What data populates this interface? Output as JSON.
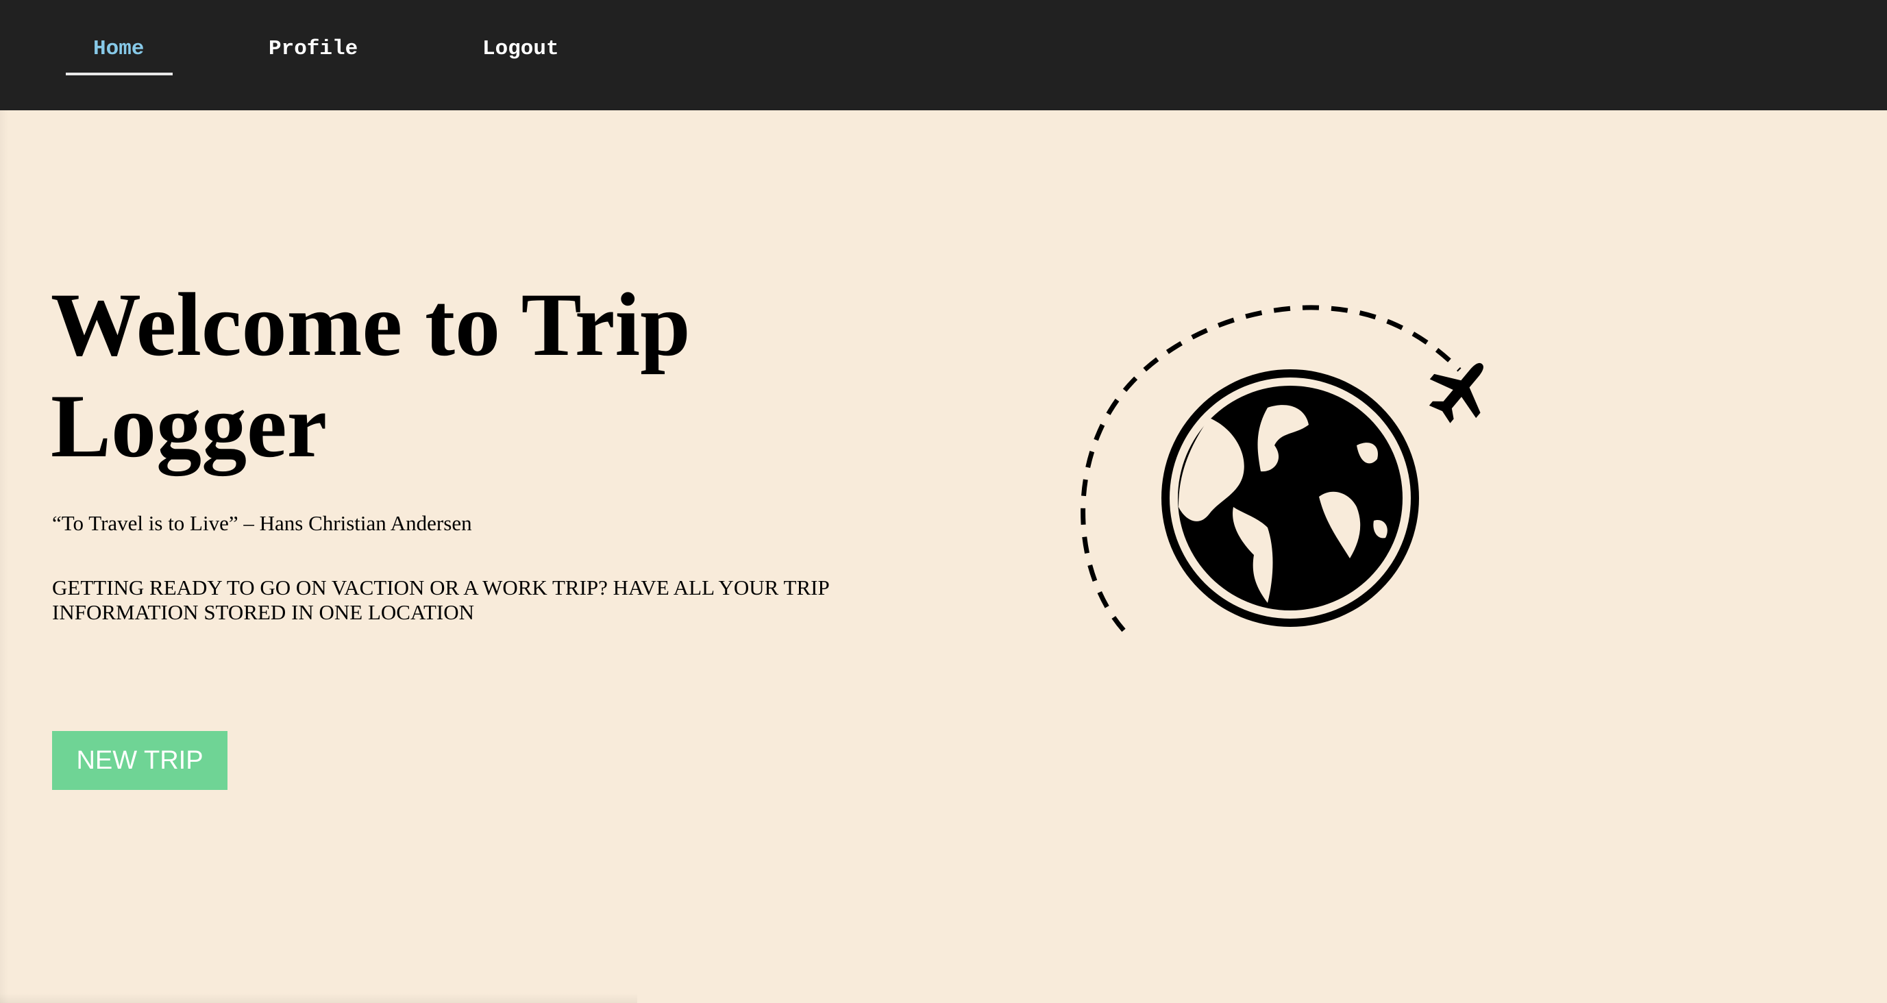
{
  "nav": {
    "items": [
      {
        "label": "Home",
        "active": true
      },
      {
        "label": "Profile",
        "active": false
      },
      {
        "label": "Logout",
        "active": false
      }
    ]
  },
  "hero": {
    "title": "Welcome to Trip Logger",
    "quote": "“To Travel is to Live” – Hans Christian Andersen",
    "tagline": "GETTING READY TO GO ON VACTION OR A WORK TRIP? HAVE ALL YOUR TRIP INFORMATION STORED IN ONE LOCATION",
    "button_label": "NEW TRIP"
  },
  "illustration": {
    "icons": [
      "globe-icon",
      "airplane-icon",
      "dashed-flight-path"
    ]
  },
  "colors": {
    "background": "#f8ebda",
    "navbar": "#212121",
    "nav_active": "#87c9e8",
    "button": "#6fd495",
    "text": "#000000"
  }
}
